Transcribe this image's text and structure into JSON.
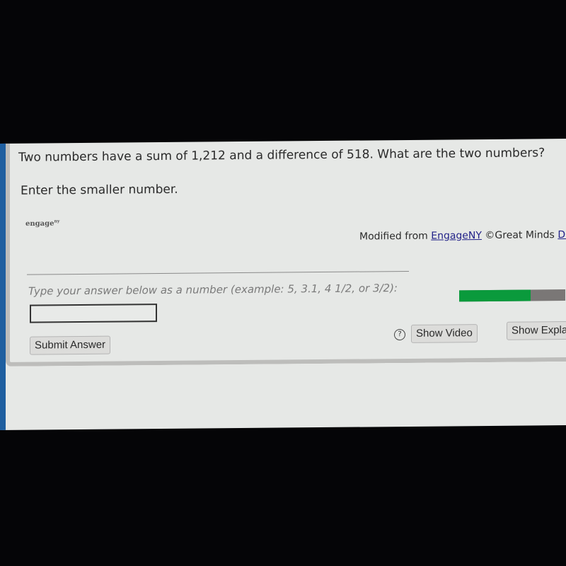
{
  "question": {
    "text": "Two numbers have a sum of 1,212 and a difference of 518. What are the two numbers?",
    "prompt": "Enter the smaller number."
  },
  "logo": {
    "name": "engage",
    "superscript": "ny"
  },
  "credit": {
    "prefix": "Modified from ",
    "link_text": "EngageNY",
    "middle": " ©Great Minds ",
    "link2_text": "Disc"
  },
  "answer": {
    "instruction": "Type your answer below as a number (example: 5, 3.1, 4 1/2, or 3/2):",
    "value": "",
    "placeholder": ""
  },
  "progress": {
    "percent": 67,
    "fill_color": "#0a9a3c",
    "track_color": "#7a7776"
  },
  "buttons": {
    "submit": "Submit Answer",
    "help_icon_glyph": "?",
    "show_video": "Show Video",
    "show_explanation": "Show Explan"
  }
}
